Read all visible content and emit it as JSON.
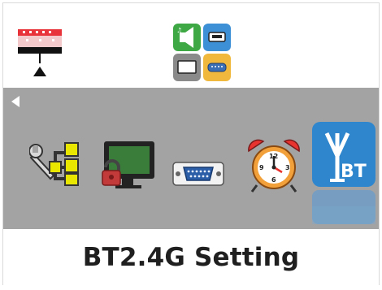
{
  "status": {
    "icons": [
      "input-source-icon",
      "hdmi-icon",
      "display-icon",
      "serial-port-icon"
    ],
    "indicator": [
      "signal-meter-icon",
      "up-arrow-icon"
    ]
  },
  "menu": {
    "items": [
      {
        "name": "network-settings-icon"
      },
      {
        "name": "display-lock-icon"
      },
      {
        "name": "rs232-port-icon"
      },
      {
        "name": "alarm-clock-icon"
      },
      {
        "name": "bluetooth-signal-icon",
        "selected": true
      }
    ],
    "selected_label": "BT2.4G Setting"
  },
  "colors": {
    "strip": "#a3a3a3",
    "highlight": "#2f86cc",
    "label_text": "#1f1f1f"
  }
}
